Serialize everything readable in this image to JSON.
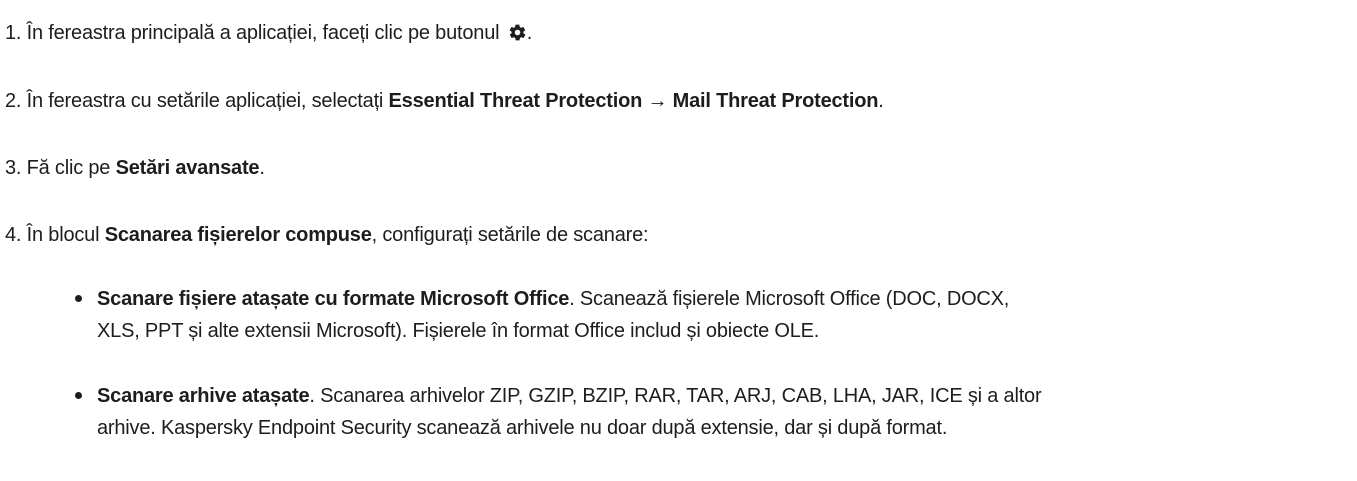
{
  "steps": [
    {
      "number": "1.",
      "text_before": "În fereastra principală a aplicației, faceți clic pe butonul",
      "icon": "gear-icon",
      "text_after": "."
    },
    {
      "number": "2.",
      "text_before": "În fereastra cu setările aplicației, selectați",
      "bold_1": "Essential Threat Protection",
      "arrow": "→",
      "bold_2": "Mail Threat Protection",
      "text_after": "."
    },
    {
      "number": "3.",
      "text_before": "Fă clic pe",
      "bold": "Setări avansate",
      "text_after": "."
    },
    {
      "number": "4.",
      "text_before": "În blocul",
      "bold": "Scanarea fișierelor compuse",
      "text_after": ", configurați setările de scanare:"
    }
  ],
  "bullets": [
    {
      "bold": "Scanare fișiere atașate cu formate Microsoft Office",
      "line1": ". Scanează fișierele Microsoft Office (DOC, DOCX,",
      "line2": "XLS, PPT și alte extensii Microsoft). Fișierele în format Office includ și obiecte OLE."
    },
    {
      "bold": "Scanare arhive atașate",
      "line1": ". Scanarea arhivelor ZIP, GZIP, BZIP, RAR, TAR, ARJ, CAB, LHA, JAR, ICE și a altor",
      "line2": "arhive. Kaspersky Endpoint Security scanează arhivele nu doar după extensie, dar și după format."
    }
  ]
}
